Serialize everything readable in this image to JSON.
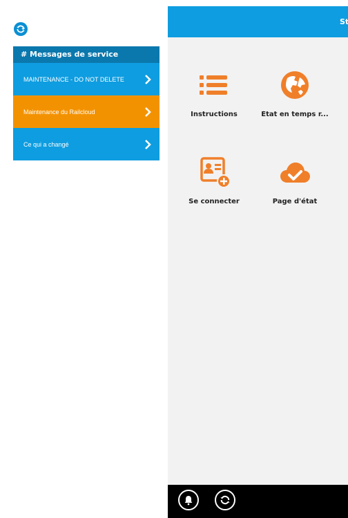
{
  "sidebar": {
    "refresh_icon": "refresh-icon",
    "messages_header": "# Messages de service",
    "items": [
      {
        "label": "MAINTENANCE - DO NOT DELETE",
        "color": "#0e9de0"
      },
      {
        "label": "Maintenance du Railcloud",
        "color": "#f39200"
      },
      {
        "label": "Ce qui a changé",
        "color": "#0e9de0"
      }
    ]
  },
  "main": {
    "header_title": "St",
    "header_color": "#0e9de0",
    "accent_color": "#f07f2a",
    "tiles": [
      {
        "label": "Instructions",
        "icon": "list-icon"
      },
      {
        "label": "État en temps r...",
        "icon": "globe-icon"
      },
      {
        "label": "Se connecter",
        "icon": "contact-card-add-icon"
      },
      {
        "label": "Page d'état",
        "icon": "cloud-check-icon"
      }
    ]
  },
  "bottom_bar": {
    "icons": [
      "bell-icon",
      "refresh-icon"
    ]
  }
}
